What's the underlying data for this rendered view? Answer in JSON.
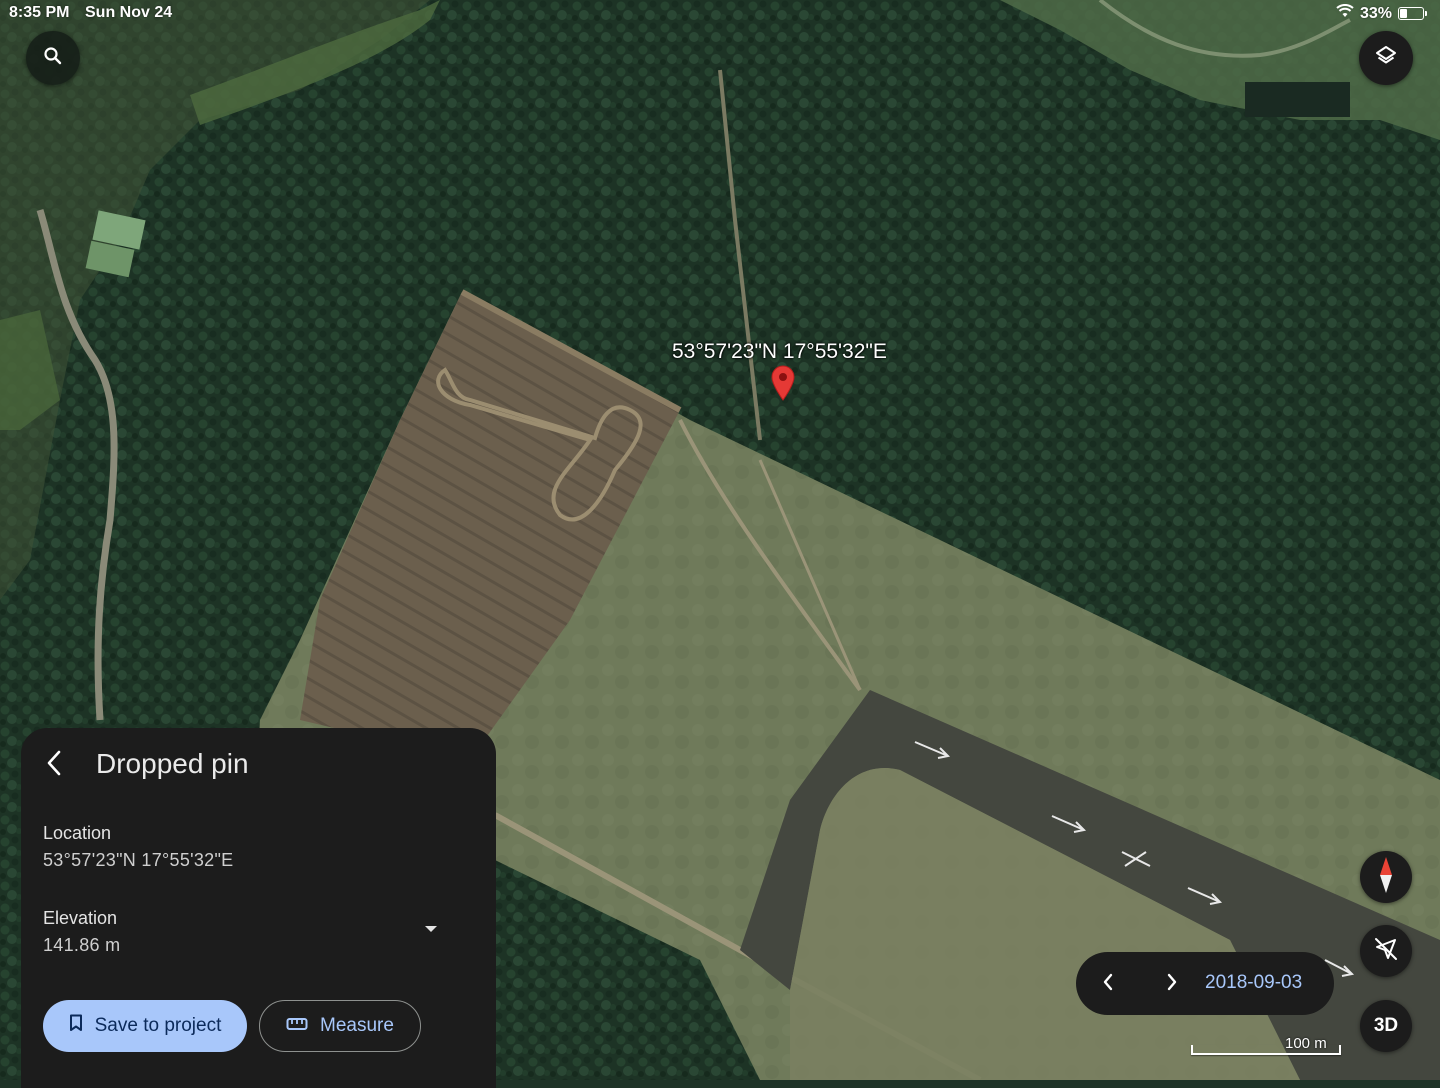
{
  "status_bar": {
    "time": "8:35 PM",
    "date": "Sun Nov 24",
    "battery": "33%",
    "battery_level": 0.33
  },
  "map": {
    "pin_label": "53°57'23\"N 17°55'32\"E",
    "pin_color": "#e53935"
  },
  "controls": {
    "search_icon": "search-icon",
    "layers_icon": "layers-icon",
    "compass_icon": "compass-icon",
    "location_icon": "location-off-icon",
    "three_d_label": "3D"
  },
  "panel": {
    "title": "Dropped pin",
    "location_label": "Location",
    "location_value": "53°57'23\"N 17°55'32\"E",
    "elevation_label": "Elevation",
    "elevation_value": "141.86 m",
    "save_label": "Save to project",
    "measure_label": "Measure"
  },
  "imagery": {
    "date": "2018-09-03"
  },
  "scale": {
    "label": "100 m"
  },
  "colors": {
    "accent": "#a8c7fa",
    "panel_bg": "#1c1c1c",
    "save_text": "#0b2a5a"
  }
}
